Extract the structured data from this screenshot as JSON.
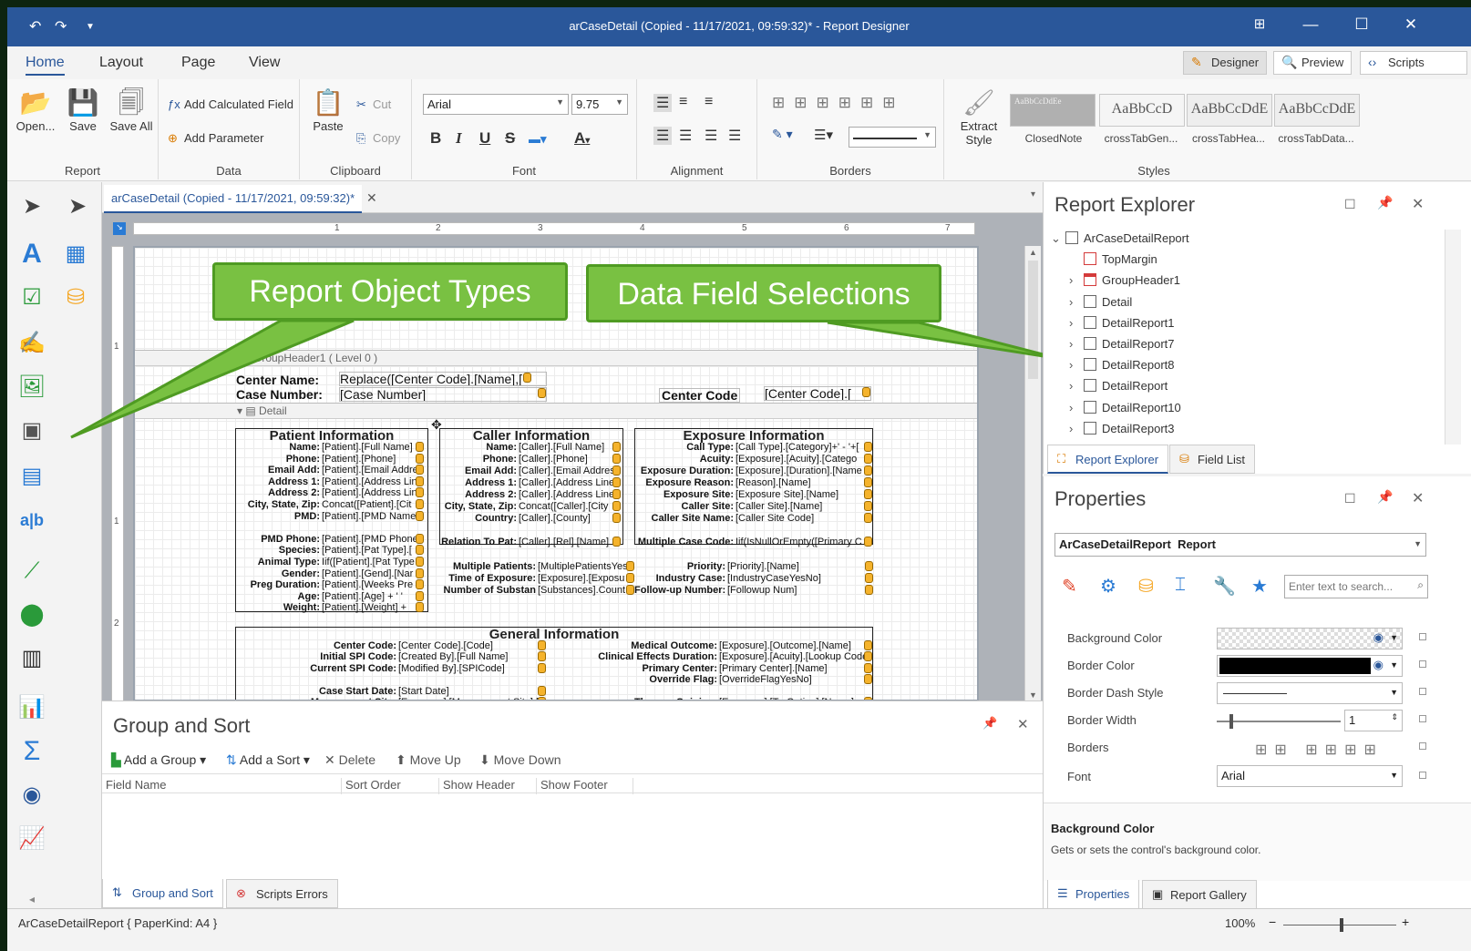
{
  "window": {
    "title": "arCaseDetail (Copied - 11/17/2021, 09:59:32)* - Report Designer"
  },
  "ribbon_tabs": [
    "Home",
    "Layout",
    "Page",
    "View"
  ],
  "view_buttons": {
    "designer": "Designer",
    "preview": "Preview",
    "scripts": "Scripts"
  },
  "groups": {
    "report": "Report",
    "data": "Data",
    "clipboard": "Clipboard",
    "font": "Font",
    "alignment": "Alignment",
    "borders": "Borders",
    "styles": "Styles"
  },
  "report_buttons": {
    "open": "Open...",
    "save": "Save",
    "save_all": "Save All"
  },
  "data_buttons": {
    "calc": "Add Calculated Field",
    "param": "Add Parameter"
  },
  "clipboard": {
    "paste": "Paste",
    "cut": "Cut",
    "copy": "Copy"
  },
  "font": {
    "name": "Arial",
    "size": "9.75"
  },
  "extract_style": "Extract Style",
  "styles": [
    {
      "preview": "AaBbCcDdEe",
      "caption": "ClosedNote"
    },
    {
      "preview": "AaBbCcD",
      "caption": "crossTabGen..."
    },
    {
      "preview": "AaBbCcDdE",
      "caption": "crossTabHea..."
    },
    {
      "preview": "AaBbCcDdE",
      "caption": "crossTabData..."
    }
  ],
  "doc_tab": "arCaseDetail (Copied - 11/17/2021, 09:59:32)*",
  "ruler": [
    "1",
    "2",
    "3",
    "4",
    "5",
    "6",
    "7"
  ],
  "vruler": [
    "1",
    "1",
    "2"
  ],
  "callouts": {
    "left": "Report Object Types",
    "right": "Data Field Selections"
  },
  "bands": {
    "group_header": "GroupHeader1 ( Level 0 )",
    "detail": "Detail"
  },
  "header_fields": {
    "center_name_lbl": "Center Name:",
    "center_name_val": "Replace([Center Code].[Name],[",
    "case_number_lbl": "Case Number:",
    "case_number_val": "[Case Number]",
    "center_code_lbl": "Center Code",
    "center_code_val": "[Center Code].["
  },
  "patient": {
    "title": "Patient Information",
    "rows": [
      [
        "Name:",
        "[Patient].[Full Name]"
      ],
      [
        "Phone:",
        "[Patient].[Phone]"
      ],
      [
        "Email Add:",
        "[Patient].[Email Addre"
      ],
      [
        "Address 1:",
        "[Patient].[Address Lin"
      ],
      [
        "Address 2:",
        "[Patient].[Address Lin"
      ],
      [
        "City, State, Zip:",
        "Concat([Patient].[Cit"
      ],
      [
        "PMD:",
        "[Patient].[PMD Name"
      ],
      [
        "",
        ""
      ],
      [
        "PMD Phone:",
        "[Patient].[PMD Phone"
      ],
      [
        "Species:",
        "[Patient].[Pat Type].["
      ],
      [
        "Animal Type:",
        "Iif([Patient].[Pat Type"
      ],
      [
        "Gender:",
        "[Patient].[Gend].[Nar"
      ],
      [
        "Preg Duration:",
        "[Patient].[Weeks Pre"
      ],
      [
        "Age:",
        "[Patient].[Age] + ' '"
      ],
      [
        "Weight:",
        "[Patient].[Weight] +"
      ]
    ]
  },
  "caller": {
    "title": "Caller Information",
    "rows": [
      [
        "Name:",
        "[Caller].[Full Name]"
      ],
      [
        "Phone:",
        "[Caller].[Phone]"
      ],
      [
        "Email Add:",
        "[Caller].[Email Addres"
      ],
      [
        "Address 1:",
        "[Caller].[Address Line"
      ],
      [
        "Address 2:",
        "[Caller].[Address Line"
      ],
      [
        "City, State, Zip:",
        "Concat([Caller].[City"
      ],
      [
        "Country:",
        "[Caller].[County]"
      ],
      [
        "",
        ""
      ],
      [
        "Relation To Pat:",
        "[Caller].[Rel].[Name]"
      ]
    ]
  },
  "exposure": {
    "title": "Exposure Information",
    "rows": [
      [
        "Call Type:",
        "[Call Type].[Category]+' - '+["
      ],
      [
        "Acuity:",
        "[Exposure].[Acuity].[Catego"
      ],
      [
        "Exposure Duration:",
        "[Exposure].[Duration].[Name"
      ],
      [
        "Exposure Reason:",
        "[Reason].[Name]"
      ],
      [
        "Exposure Site:",
        "[Exposure Site].[Name]"
      ],
      [
        "Caller Site:",
        "[Caller Site].[Name]"
      ],
      [
        "Caller Site Name:",
        "[Caller Site Code]"
      ],
      [
        "",
        ""
      ],
      [
        "Multiple Case Code:",
        "Iif(IsNullOrEmpty([Primary C"
      ]
    ]
  },
  "mid_fields": [
    [
      "Multiple Patients:",
      "[MultiplePatientsYes"
    ],
    [
      "Time of Exposure:",
      "[Exposure].[Exposu"
    ],
    [
      "Number of Substan",
      "[Substances].Count"
    ]
  ],
  "mid_fields2": [
    [
      "Priority:",
      "[Priority].[Name]"
    ],
    [
      "Industry Case:",
      "[IndustryCaseYesNo]"
    ],
    [
      "Follow-up Number:",
      "[Followup Num]"
    ]
  ],
  "general": {
    "title": "General Information",
    "left": [
      [
        "Center Code:",
        "[Center Code].[Code]"
      ],
      [
        "Initial SPI Code:",
        "[Created By].[Full Name]"
      ],
      [
        "Current SPI Code:",
        "[Modified By].[SPICode]"
      ],
      [
        "",
        ""
      ],
      [
        "Case Start Date:",
        "[Start Date]"
      ],
      [
        "Management Site:",
        "[Exposure].[Management Site].[Na"
      ]
    ],
    "right": [
      [
        "Medical Outcome:",
        "[Exposure].[Outcome].[Name]"
      ],
      [
        "Clinical Effects Duration:",
        "[Exposure].[Acuity].[Lookup Code"
      ],
      [
        "Primary Center:",
        "[Primary Center].[Name]"
      ],
      [
        "Override Flag:",
        "[OverrideFlagYesNo]"
      ],
      [
        "",
        ""
      ],
      [
        "Therapy Opinion:",
        "[Exposure].[Tx Option].[Name]"
      ]
    ]
  },
  "group_sort": {
    "title": "Group and Sort",
    "add_group": "Add a Group",
    "add_sort": "Add a Sort",
    "delete": "Delete",
    "move_up": "Move Up",
    "move_down": "Move Down",
    "columns": [
      "Field Name",
      "Sort Order",
      "Show Header",
      "Show Footer"
    ]
  },
  "bottom_tabs": {
    "group_sort": "Group and Sort",
    "scripts_errors": "Scripts Errors"
  },
  "explorer": {
    "title": "Report Explorer",
    "items": [
      "ArCaseDetailReport",
      "TopMargin",
      "GroupHeader1",
      "Detail",
      "DetailReport1",
      "DetailReport7",
      "DetailReport8",
      "DetailReport",
      "DetailReport10",
      "DetailReport3"
    ],
    "tab_explorer": "Report Explorer",
    "tab_fields": "Field List"
  },
  "properties": {
    "title": "Properties",
    "selector": "ArCaseDetailReport",
    "selector_type": "Report",
    "search_placeholder": "Enter text to search...",
    "rows": [
      "Background Color",
      "Border Color",
      "Border Dash Style",
      "Border Width",
      "Borders",
      "Font"
    ],
    "border_width": "1",
    "font_value": "Arial",
    "desc_title": "Background Color",
    "desc_text": "Gets or sets the control's background color.",
    "tab_props": "Properties",
    "tab_gallery": "Report Gallery"
  },
  "status": {
    "left": "ArCaseDetailReport { PaperKind: A4 }",
    "zoom": "100%"
  },
  "colors": {
    "titlebar": "#2a579a",
    "accent": "#2a579a",
    "callout": "#79c142"
  }
}
